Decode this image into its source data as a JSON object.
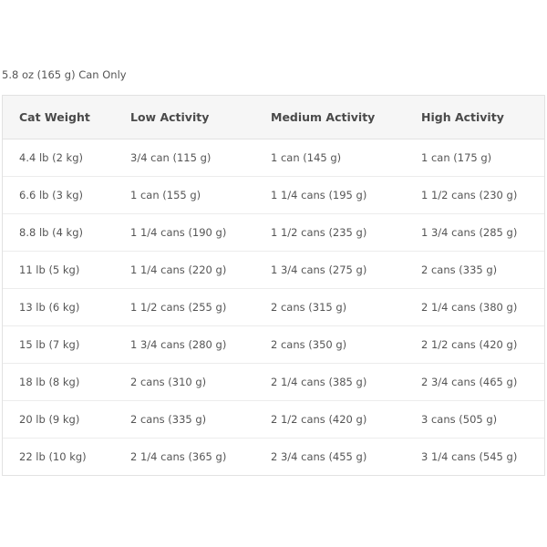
{
  "caption": "5.8 oz (165 g) Can Only",
  "table": {
    "headers": [
      "Cat Weight",
      "Low Activity",
      "Medium Activity",
      "High Activity"
    ],
    "rows": [
      [
        "4.4 lb (2 kg)",
        "3/4 can (115 g)",
        "1 can (145 g)",
        "1 can (175 g)"
      ],
      [
        "6.6 lb (3 kg)",
        "1 can (155 g)",
        "1 1/4 cans (195 g)",
        "1 1/2 cans (230 g)"
      ],
      [
        "8.8 lb (4 kg)",
        "1 1/4 cans (190 g)",
        "1 1/2 cans (235 g)",
        "1 3/4 cans (285 g)"
      ],
      [
        "11 lb (5 kg)",
        "1 1/4 cans (220 g)",
        "1 3/4 cans (275 g)",
        "2 cans (335 g)"
      ],
      [
        "13 lb (6 kg)",
        "1 1/2 cans (255 g)",
        "2 cans (315 g)",
        "2 1/4 cans (380 g)"
      ],
      [
        "15 lb (7 kg)",
        "1 3/4 cans (280 g)",
        "2 cans (350 g)",
        "2 1/2 cans (420 g)"
      ],
      [
        "18 lb (8 kg)",
        "2 cans (310 g)",
        "2 1/4 cans (385 g)",
        "2 3/4 cans (465 g)"
      ],
      [
        "20 lb (9 kg)",
        "2 cans (335 g)",
        "2 1/2 cans (420 g)",
        "3 cans (505 g)"
      ],
      [
        "22 lb (10 kg)",
        "2 1/4 cans (365 g)",
        "2 3/4 cans (455 g)",
        "3 1/4 cans (545 g)"
      ]
    ]
  }
}
